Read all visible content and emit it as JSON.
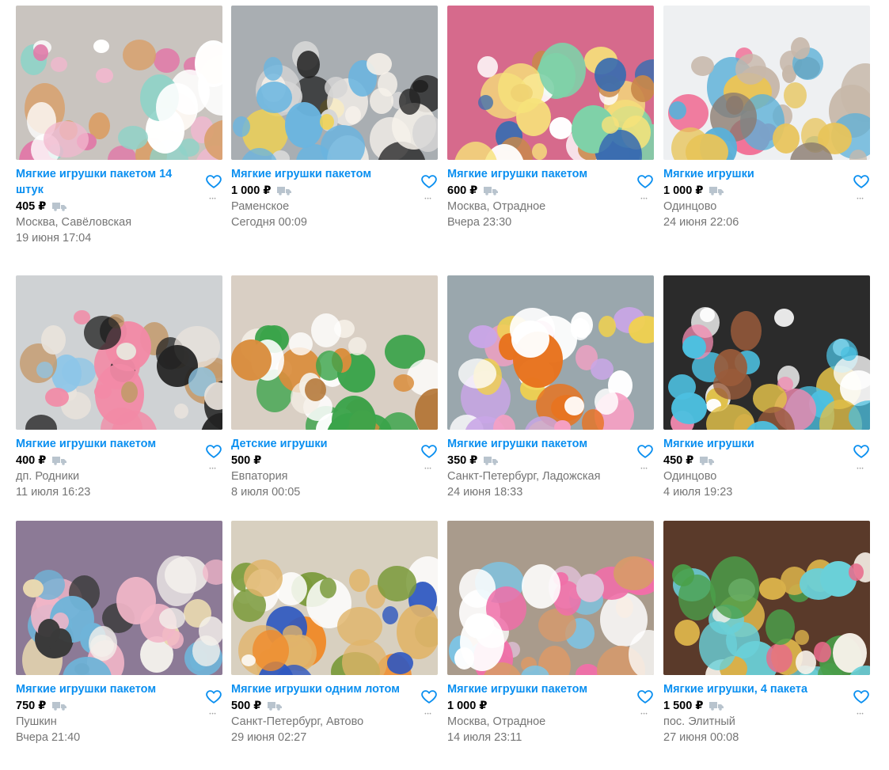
{
  "colors": {
    "title": "#0a8ff0",
    "heart": "#0a8ff0",
    "meta": "#757575",
    "truck": "#b9c4ce"
  },
  "items": [
    {
      "title": "Мягкие игрушки пакетом 14 штук",
      "price": "405 ₽",
      "delivery": true,
      "location": "Москва, Савёловская",
      "date": "19 июня 17:04"
    },
    {
      "title": "Мягкие игрушки пакетом",
      "price": "1 000 ₽",
      "delivery": true,
      "location": "Раменское",
      "date": "Сегодня 00:09"
    },
    {
      "title": "Мягкие игрушки пакетом",
      "price": "600 ₽",
      "delivery": true,
      "location": "Москва, Отрадное",
      "date": "Вчера 23:30"
    },
    {
      "title": "Мягкие игрушки",
      "price": "1 000 ₽",
      "delivery": true,
      "location": "Одинцово",
      "date": "24 июня 22:06"
    },
    {
      "title": "Мягкие игрушки пакетом",
      "price": "400 ₽",
      "delivery": true,
      "location": "дп. Родники",
      "date": "11 июля 16:23"
    },
    {
      "title": "Детские игрушки",
      "price": "500 ₽",
      "delivery": false,
      "location": "Евпатория",
      "date": "8 июля 00:05"
    },
    {
      "title": "Мягкие игрушки пакетом",
      "price": "350 ₽",
      "delivery": true,
      "location": "Санкт-Петербург, Ладожская",
      "date": "24 июня 18:33"
    },
    {
      "title": "Мягкие игрушки",
      "price": "450 ₽",
      "delivery": true,
      "location": "Одинцово",
      "date": "4 июля 19:23"
    },
    {
      "title": "Мягкие игрушки пакетом",
      "price": "750 ₽",
      "delivery": true,
      "location": "Пушкин",
      "date": "Вчера 21:40"
    },
    {
      "title": "Мягкие игрушки одним лотом",
      "price": "500 ₽",
      "delivery": true,
      "location": "Санкт-Петербург, Автово",
      "date": "29 июня 02:27"
    },
    {
      "title": "Мягкие игрушки пакетом",
      "price": "1 000 ₽",
      "delivery": false,
      "location": "Москва, Отрадное",
      "date": "14 июля 23:11"
    },
    {
      "title": "Мягкие игрушки, 4 пакета",
      "price": "1 500 ₽",
      "delivery": true,
      "location": "пос. Элитный",
      "date": "27 июня 00:08"
    }
  ]
}
